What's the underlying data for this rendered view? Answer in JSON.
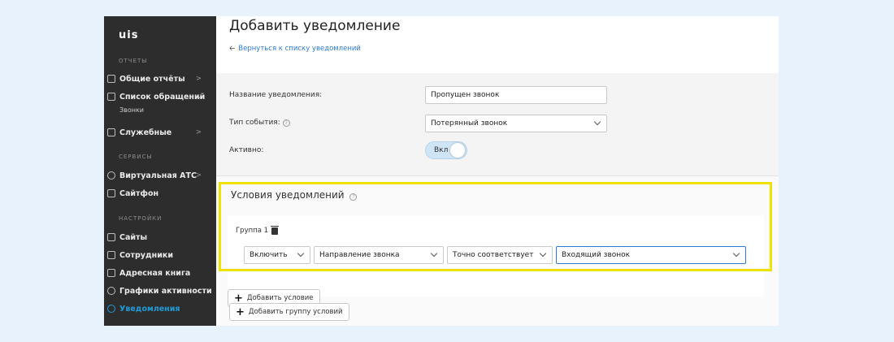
{
  "sidebar": {
    "logo": "uis",
    "sections": [
      {
        "title": "ОТЧЕТЫ"
      },
      {
        "title": "СЕРВИСЫ"
      },
      {
        "title": "НАСТРОЙКИ"
      }
    ],
    "items": [
      {
        "label": "Общие отчёты",
        "arrow": ">"
      },
      {
        "label": "Список обращений",
        "arrow": "v",
        "sub": "Звонки"
      },
      {
        "label": "Служебные",
        "arrow": ">"
      },
      {
        "label": "Виртуальная АТС",
        "arrow": ">"
      },
      {
        "label": "Сайтфон",
        "arrow": ""
      },
      {
        "label": "Сайты",
        "arrow": ""
      },
      {
        "label": "Сотрудники",
        "arrow": ""
      },
      {
        "label": "Адресная книга",
        "arrow": ""
      },
      {
        "label": "Графики активности",
        "arrow": ""
      },
      {
        "label": "Уведомления",
        "arrow": "",
        "active": true
      }
    ]
  },
  "header": {
    "title": "Добавить уведомление",
    "back_link": "Вернуться к списку уведомлений"
  },
  "form": {
    "name_label": "Название уведомления:",
    "name_value": "Пропущен звонок",
    "event_label": "Тип события:",
    "event_value": "Потерянный звонок",
    "active_label": "Активно:",
    "active_value": "Вкл"
  },
  "conditions": {
    "title": "Условия уведомлений",
    "group_label": "Группа 1",
    "selects": [
      "Включить",
      "Направление звонка",
      "Точно соответствует",
      "Входящий звонок"
    ],
    "add_condition": "Добавить условие",
    "add_group": "Добавить группу условий"
  },
  "colors": {
    "highlight": "#f0e200",
    "accent": "#1e9bd7",
    "link": "#2a7bd1"
  }
}
